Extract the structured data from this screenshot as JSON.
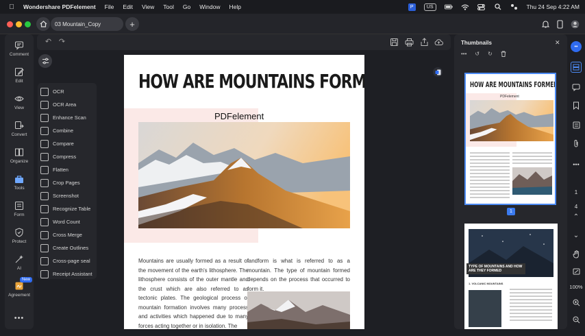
{
  "menubar": {
    "app_name": "Wondershare PDFelement",
    "items": [
      "File",
      "Edit",
      "View",
      "Tool",
      "Go",
      "Window",
      "Help"
    ],
    "input_badge": "US",
    "clock": "Thu 24 Sep  4:22 AM"
  },
  "tab": {
    "title": "03 Mountain_Copy"
  },
  "left_rail": [
    {
      "label": "Comment",
      "icon": "comment-icon"
    },
    {
      "label": "Edit",
      "icon": "edit-icon"
    },
    {
      "label": "View",
      "icon": "eye-icon"
    },
    {
      "label": "Convert",
      "icon": "convert-icon"
    },
    {
      "label": "Organize",
      "icon": "organize-icon"
    },
    {
      "label": "Tools",
      "icon": "toolbox-icon"
    },
    {
      "label": "Form",
      "icon": "form-icon"
    },
    {
      "label": "Protect",
      "icon": "shield-icon"
    },
    {
      "label": "AI",
      "icon": "sparkle-icon"
    },
    {
      "label": "Agreement",
      "icon": "signature-icon",
      "badge": "New"
    }
  ],
  "tools_menu": [
    "OCR",
    "OCR Area",
    "Enhance Scan",
    "Combine",
    "Compare",
    "Compress",
    "Flatten",
    "Crop Pages",
    "Screenshot",
    "Recognize Table",
    "Word Count",
    "Cross Merge",
    "Create Outlines",
    "Cross-page seal",
    "Receipt Assistant"
  ],
  "document": {
    "heading": "HOW ARE MOUNTAINS FORMED?",
    "brand": "PDFelement",
    "col1": "Mountains are usually formed as a result of the movement of the earth's lithosphere. The lithosphere consists of the outer mantle and the crust which are also referred to as tectonic plates. The geological process of mountain formation involves many process and activities which happened due to many forces acting together or in isolation. The",
    "col2": "landform is what is referred to as a mountain. The type of mountain formed depends on the process that occurred to form it."
  },
  "thumbnails": {
    "title": "Thumbnails",
    "current_page_badge": "1",
    "thumb2_caption": "TYPE OF MOUNTAINS AND HOW ARE THEY FORMED",
    "thumb2_sub": "1. VOLCANIC MOUNTAINS"
  },
  "right_rail": {
    "page_current": "1",
    "page_total": "4",
    "zoom": "100%"
  },
  "colors": {
    "accent": "#3b7bf0",
    "background": "#1e1f24",
    "panel": "#26272c"
  }
}
